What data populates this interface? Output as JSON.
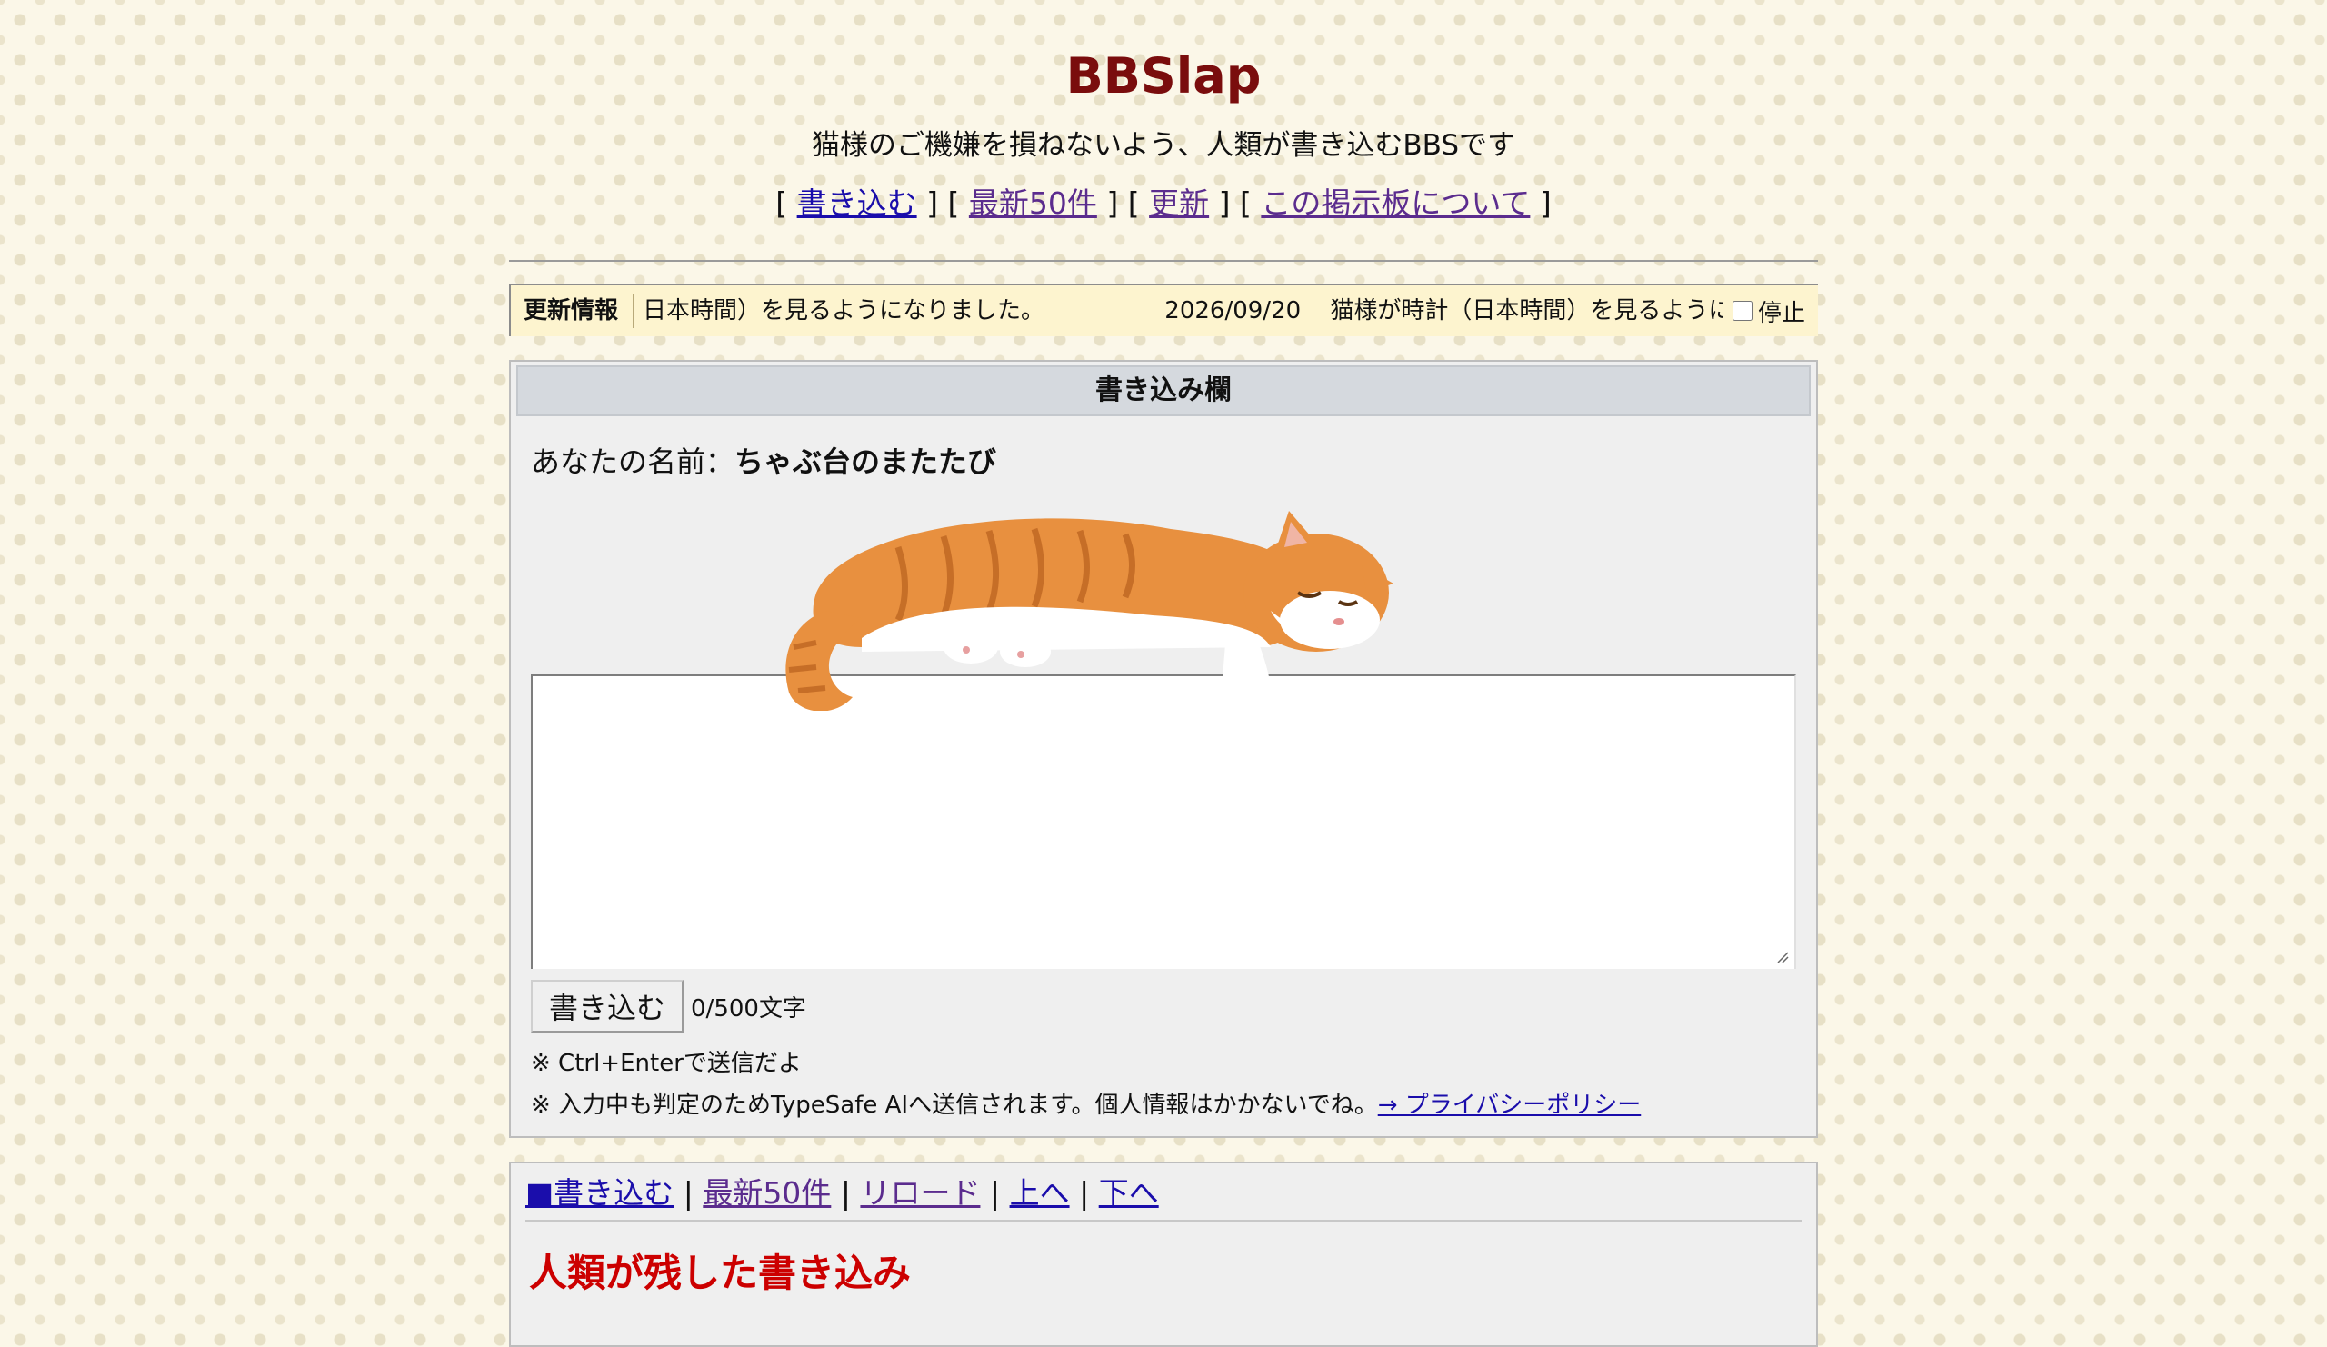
{
  "site": {
    "title": "BBSlap",
    "subtitle": "猫様のご機嫌を損ねないよう、人類が書き込むBBSです"
  },
  "topnav": {
    "open": "[",
    "close": "]",
    "items": [
      "書き込む",
      "最新50件",
      "更新",
      "この掲示板について"
    ]
  },
  "ticker": {
    "label": "更新情報",
    "text_head": "日本時間）を見るようになりました。",
    "date": "2026/09/20",
    "text": "猫様が時計（日本時間）を見るようになりました。",
    "stop_label": "停止"
  },
  "form": {
    "header": "書き込み欄",
    "name_prefix": "あなたの名前：",
    "name_value": "ちゃぶ台のまたたび",
    "textarea_value": "",
    "submit_label": "書き込む",
    "char_count": "0/500文字",
    "note1": "※ Ctrl+Enterで送信だよ",
    "note2": "※ 入力中も判定のためTypeSafe AIへ送信されます。個人情報はかかないでね。",
    "privacy_link": "→ プライバシーポリシー"
  },
  "lower": {
    "nav": [
      "■書き込む",
      "最新50件",
      "リロード",
      "上へ",
      "下へ"
    ],
    "separator": "|",
    "heading": "人類が残した書き込み"
  },
  "colors": {
    "title": "#7a0d0d",
    "heading": "#cc0000",
    "link": "#1a0dab",
    "visited": "#5b2c8e",
    "ticker_bg": "#fdf4cf"
  }
}
